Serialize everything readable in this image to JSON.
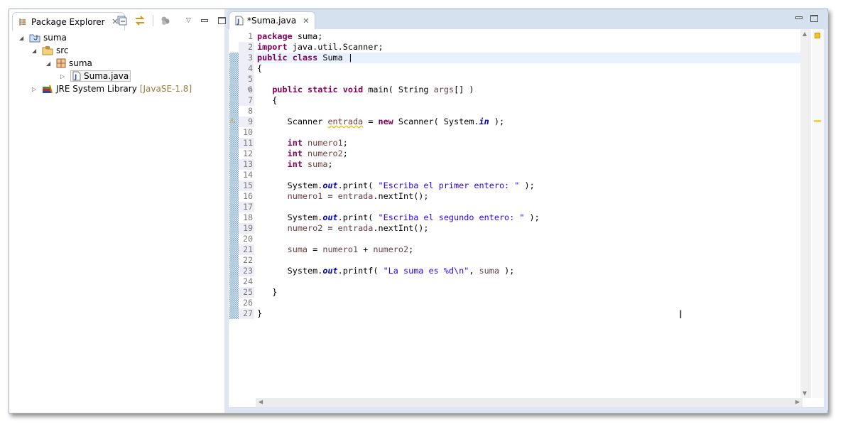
{
  "package_explorer": {
    "title": "Package Explorer",
    "tree": [
      {
        "label": "suma",
        "icon": "java-project-icon",
        "expanded": true
      },
      {
        "label": "src",
        "icon": "source-folder-icon",
        "expanded": true
      },
      {
        "label": "suma",
        "icon": "package-icon",
        "expanded": true
      },
      {
        "label": "Suma.java",
        "icon": "java-file-icon",
        "expanded": false,
        "selected": true
      },
      {
        "label": "JRE System Library",
        "decoration": "[JavaSE-1.8]",
        "icon": "library-icon",
        "expanded": false
      }
    ]
  },
  "editor": {
    "tab_title": "*Suma.java",
    "current_line": 3,
    "warning_line": 9,
    "colors": {
      "keyword": "#7f0055",
      "string": "#2a00ff",
      "field": "#0000c0",
      "local": "#6a3e3e",
      "current_line": "#e8f2fe"
    },
    "lines": [
      [
        [
          "kw",
          "package"
        ],
        [
          "t",
          " suma;"
        ]
      ],
      [
        [
          "kw",
          "import"
        ],
        [
          "t",
          " java.util.Scanner;"
        ]
      ],
      [
        [
          "kw",
          "public"
        ],
        [
          "t",
          " "
        ],
        [
          "kw",
          "class"
        ],
        [
          "t",
          " Suma |"
        ]
      ],
      [
        [
          "t",
          "{"
        ]
      ],
      [],
      [
        [
          "t",
          "   "
        ],
        [
          "kw",
          "public"
        ],
        [
          "t",
          " "
        ],
        [
          "kw",
          "static"
        ],
        [
          "t",
          " "
        ],
        [
          "kw",
          "void"
        ],
        [
          "t",
          " main( String "
        ],
        [
          "var",
          "args"
        ],
        [
          "t",
          "[] )"
        ]
      ],
      [
        [
          "t",
          "   {"
        ]
      ],
      [],
      [
        [
          "t",
          "      Scanner "
        ],
        [
          "warnvar",
          "entrada"
        ],
        [
          "t",
          " = "
        ],
        [
          "kw",
          "new"
        ],
        [
          "t",
          " Scanner( System."
        ],
        [
          "fld",
          "in"
        ],
        [
          "t",
          " );"
        ]
      ],
      [],
      [
        [
          "t",
          "      "
        ],
        [
          "kw",
          "int"
        ],
        [
          "t",
          " "
        ],
        [
          "var",
          "numero1"
        ],
        [
          "t",
          ";"
        ]
      ],
      [
        [
          "t",
          "      "
        ],
        [
          "kw",
          "int"
        ],
        [
          "t",
          " "
        ],
        [
          "var",
          "numero2"
        ],
        [
          "t",
          ";"
        ]
      ],
      [
        [
          "t",
          "      "
        ],
        [
          "kw",
          "int"
        ],
        [
          "t",
          " "
        ],
        [
          "var",
          "suma"
        ],
        [
          "t",
          ";"
        ]
      ],
      [],
      [
        [
          "t",
          "      System."
        ],
        [
          "fld",
          "out"
        ],
        [
          "t",
          ".print( "
        ],
        [
          "str",
          "\"Escriba el primer entero: \""
        ],
        [
          "t",
          " );"
        ]
      ],
      [
        [
          "t",
          "      "
        ],
        [
          "var",
          "numero1"
        ],
        [
          "t",
          " = "
        ],
        [
          "var",
          "entrada"
        ],
        [
          "t",
          ".nextInt();"
        ]
      ],
      [],
      [
        [
          "t",
          "      System."
        ],
        [
          "fld",
          "out"
        ],
        [
          "t",
          ".print( "
        ],
        [
          "str",
          "\"Escriba el segundo entero: \""
        ],
        [
          "t",
          " );"
        ]
      ],
      [
        [
          "t",
          "      "
        ],
        [
          "var",
          "numero2"
        ],
        [
          "t",
          " = "
        ],
        [
          "var",
          "entrada"
        ],
        [
          "t",
          ".nextInt();"
        ]
      ],
      [],
      [
        [
          "t",
          "      "
        ],
        [
          "var",
          "suma"
        ],
        [
          "t",
          " = "
        ],
        [
          "var",
          "numero1"
        ],
        [
          "t",
          " + "
        ],
        [
          "var",
          "numero2"
        ],
        [
          "t",
          ";"
        ]
      ],
      [],
      [
        [
          "t",
          "      System."
        ],
        [
          "fld",
          "out"
        ],
        [
          "t",
          ".printf( "
        ],
        [
          "str",
          "\"La suma es %d\\n\""
        ],
        [
          "t",
          ", "
        ],
        [
          "var",
          "suma"
        ],
        [
          "t",
          " );"
        ]
      ],
      [],
      [
        [
          "t",
          "   }"
        ]
      ],
      [],
      [
        [
          "t",
          "}"
        ]
      ]
    ],
    "line_numbers": [
      "1",
      "2",
      "3",
      "4",
      "5",
      "6",
      "7",
      "8",
      "9",
      "10",
      "11",
      "12",
      "13",
      "14",
      "15",
      "16",
      "17",
      "18",
      "19",
      "20",
      "21",
      "22",
      "23",
      "24",
      "25",
      "26",
      "27"
    ]
  }
}
